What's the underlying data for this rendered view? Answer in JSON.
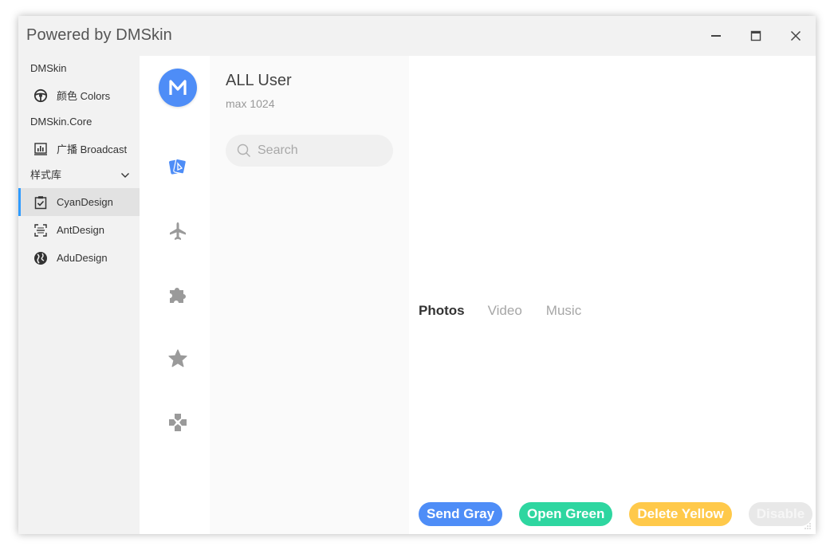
{
  "window": {
    "title": "Powered by DMSkin"
  },
  "sidebar": {
    "groups": [
      {
        "label": "DMSkin",
        "items": [
          {
            "label": "颜色 Colors",
            "icon": "steering-wheel-icon"
          }
        ]
      },
      {
        "label": "DMSkin.Core",
        "items": [
          {
            "label": "广播 Broadcast",
            "icon": "chart-icon"
          }
        ]
      },
      {
        "label": "样式库",
        "items": [
          {
            "label": "CyanDesign",
            "icon": "clipboard-check-icon",
            "active": true
          },
          {
            "label": "AntDesign",
            "icon": "scan-icon"
          },
          {
            "label": "AduDesign",
            "icon": "globe-icon"
          }
        ]
      }
    ]
  },
  "rail": {
    "avatar_letter": "M",
    "icons": [
      "cards-icon",
      "airplane-icon",
      "puzzle-icon",
      "star-icon",
      "gamepad-icon"
    ]
  },
  "list": {
    "title": "ALL User",
    "subtitle": "max 1024",
    "search_placeholder": "Search"
  },
  "content": {
    "tabs": [
      {
        "label": "Photos",
        "active": true
      },
      {
        "label": "Video"
      },
      {
        "label": "Music"
      }
    ],
    "buttons": [
      {
        "label": "Send Gray",
        "color": "#4e8df7"
      },
      {
        "label": "Open Green",
        "color": "#2ed6a0"
      },
      {
        "label": "Delete Yellow",
        "color": "#ffc94a"
      },
      {
        "label": "Disable",
        "color": "#e8e8e8",
        "disabled": true
      }
    ]
  },
  "colors": {
    "accent": "#2f9bff",
    "avatar": "#4e8df7",
    "rail_active": "#4e8df7",
    "rail_icon": "#9a9a9a"
  }
}
